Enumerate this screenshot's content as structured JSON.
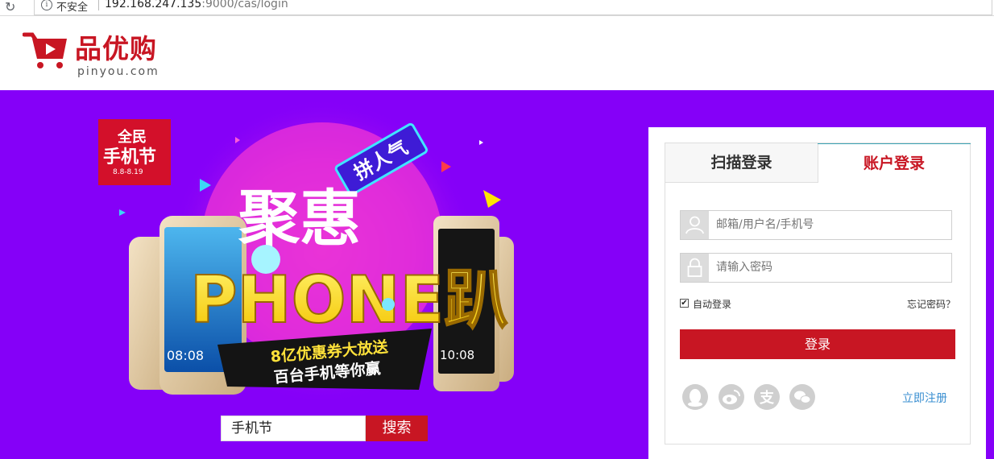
{
  "browser": {
    "security_label": "不安全",
    "url_host": "192.168.247.135",
    "url_rest": ":9000/cas/login"
  },
  "header": {
    "logo_cn": "品优购",
    "logo_en": "pinyou.com"
  },
  "banner": {
    "badge_line1": "全民",
    "badge_line2": "手机节",
    "badge_date": "8.8-8.19",
    "ribbon": "拼人气",
    "headline_cn": "聚惠",
    "headline_en": "PHONE趴",
    "slogan_line1": "8亿优惠券大放送",
    "slogan_line2": "百台手机等你赢",
    "phone_time": "08:08",
    "phone_time2": "10:08",
    "search_value": "手机节",
    "search_button": "搜索",
    "accent_color": "#8500f8"
  },
  "login": {
    "tab_scan": "扫描登录",
    "tab_account": "账户登录",
    "username_placeholder": "邮箱/用户名/手机号",
    "password_placeholder": "请输入密码",
    "auto_login": "自动登录",
    "forgot_password": "忘记密码？",
    "submit": "登录",
    "register": "立即注册",
    "social_icons": [
      "qq-icon",
      "weibo-icon",
      "alipay-icon",
      "wechat-icon"
    ],
    "brand_color": "#c81623"
  }
}
